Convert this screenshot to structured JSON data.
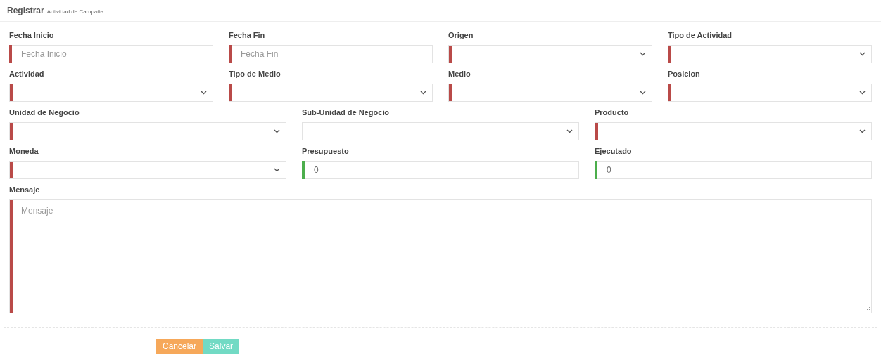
{
  "header": {
    "title": "Registrar",
    "subtitle": "Actividad de Campaña."
  },
  "rows": [
    [
      {
        "label": "Fecha Inicio",
        "kind": "text",
        "color": "#b94a48",
        "placeholder": "Fecha Inicio"
      },
      {
        "label": "Fecha Fin",
        "kind": "text",
        "color": "#b94a48",
        "placeholder": "Fecha Fin"
      },
      {
        "label": "Origen",
        "kind": "select",
        "color": "#b94a48"
      },
      {
        "label": "Tipo de Actividad",
        "kind": "select",
        "color": "#b94a48"
      }
    ],
    [
      {
        "label": "Actividad",
        "kind": "select",
        "color": "#b94a48"
      },
      {
        "label": "Tipo de Medio",
        "kind": "select",
        "color": "#b94a48"
      },
      {
        "label": "Medio",
        "kind": "select",
        "color": "#b94a48"
      },
      {
        "label": "Posicion",
        "kind": "select",
        "color": "#b94a48"
      }
    ],
    [
      {
        "label": "Unidad de Negocio",
        "kind": "select",
        "color": "#b94a48"
      },
      {
        "label": "Sub-Unidad de Negocio",
        "kind": "select"
      },
      {
        "label": "Producto",
        "kind": "select",
        "color": "#b94a48"
      }
    ],
    [
      {
        "label": "Moneda",
        "kind": "select",
        "color": "#b94a48"
      },
      {
        "label": "Presupuesto",
        "kind": "text",
        "color": "#4cae4c",
        "value": "0"
      },
      {
        "label": "Ejecutado",
        "kind": "text",
        "color": "#4cae4c",
        "value": "0"
      }
    ],
    [
      {
        "label": "Mensaje",
        "kind": "textarea",
        "color": "#b94a48",
        "placeholder": "Mensaje"
      }
    ]
  ],
  "buttons": [
    {
      "label": "Cancelar",
      "kind": "cancel"
    },
    {
      "label": "Salvar",
      "kind": "save"
    }
  ]
}
